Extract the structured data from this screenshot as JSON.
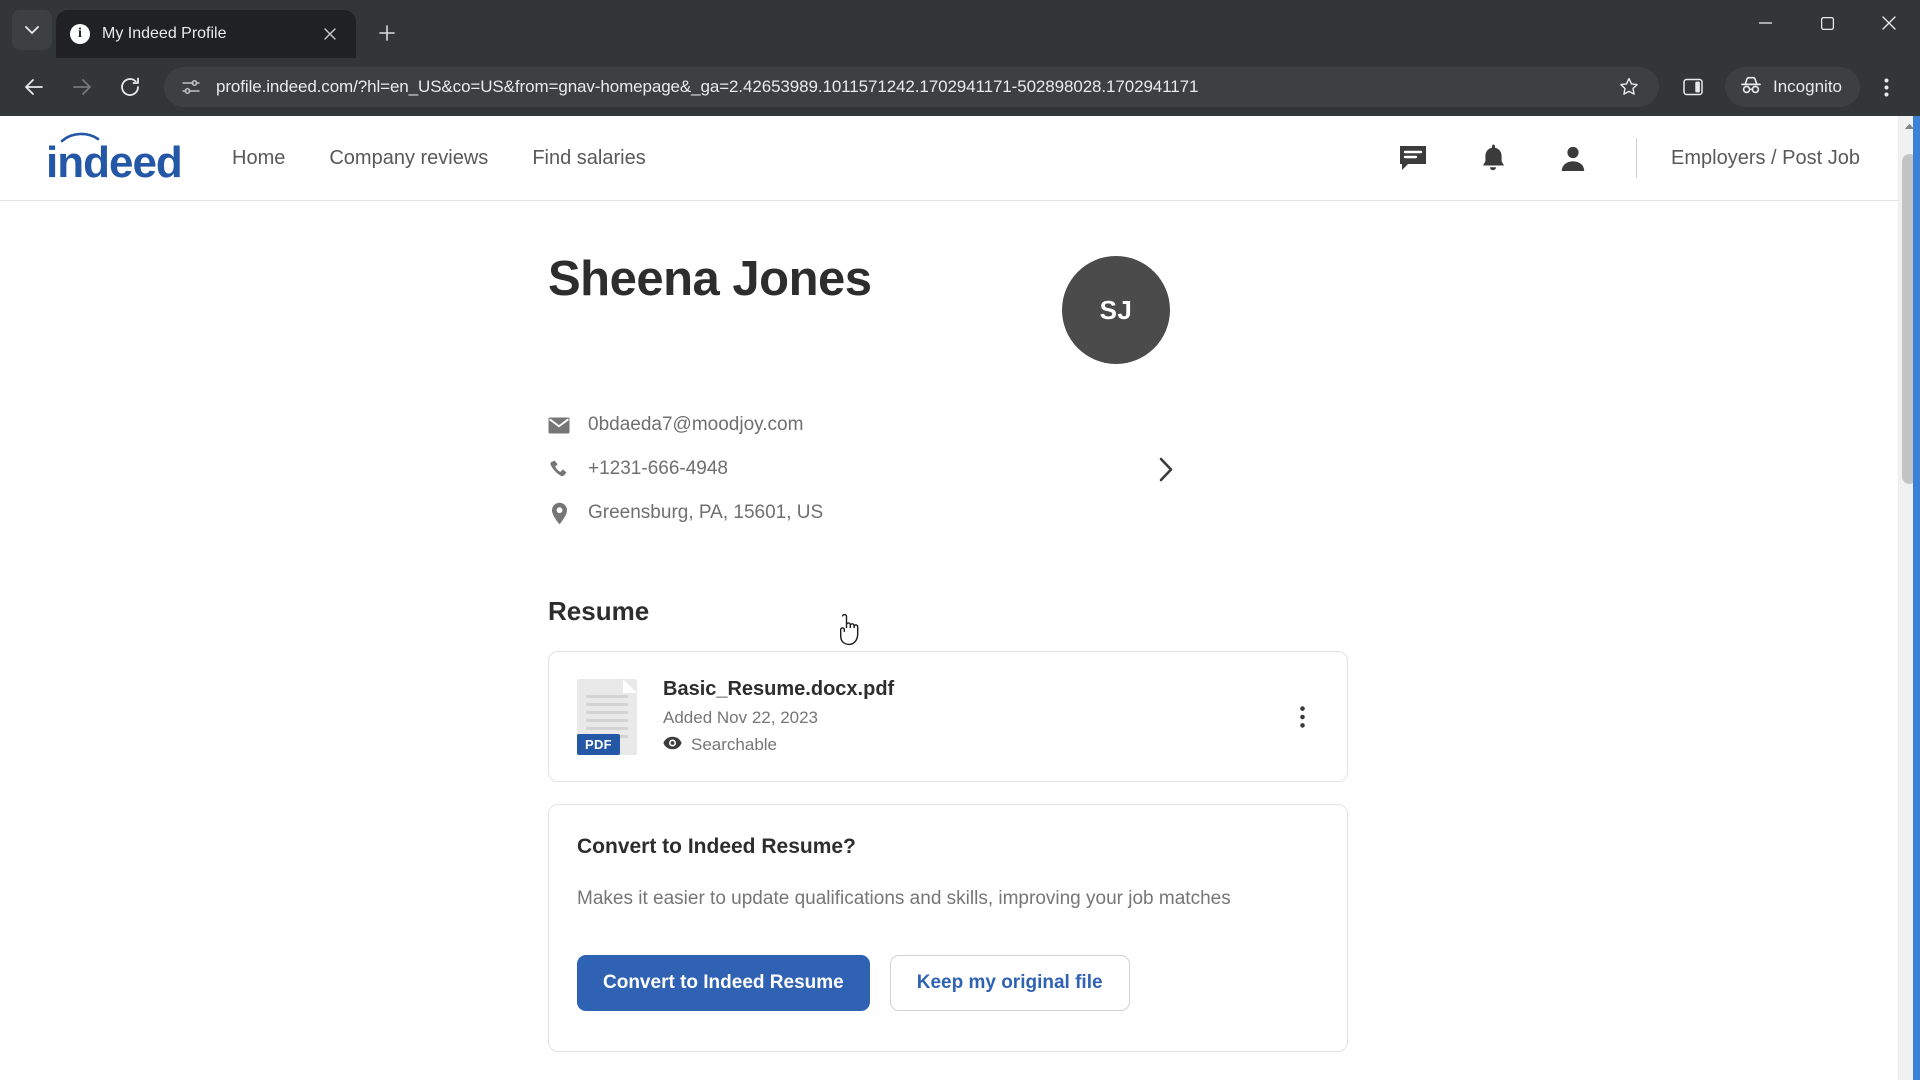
{
  "browser": {
    "tab": {
      "title": "My Indeed Profile",
      "favicon_icon": "info-circle-icon",
      "close_icon": "close-icon"
    },
    "new_tab_label": "+",
    "tab_list_icon": "chevron-down-icon",
    "window": {
      "minimize_icon": "minimize-icon",
      "maximize_icon": "maximize-icon",
      "close_icon": "window-close-icon"
    },
    "toolbar": {
      "back_icon": "back-arrow-icon",
      "forward_icon": "forward-arrow-icon",
      "reload_icon": "reload-icon",
      "site_info_icon": "site-settings-icon",
      "url": "profile.indeed.com/?hl=en_US&co=US&from=gnav-homepage&_ga=2.42653989.1011571242.1702941171-502898028.1702941171",
      "bookmark_icon": "star-icon",
      "side_panel_icon": "side-panel-icon",
      "incognito_label": "Incognito",
      "incognito_icon": "incognito-icon",
      "menu_icon": "three-dot-menu-icon"
    }
  },
  "site_header": {
    "logo_text": "indeed",
    "logo_color": "#2557a7",
    "nav": [
      {
        "label": "Home"
      },
      {
        "label": "Company reviews"
      },
      {
        "label": "Find salaries"
      }
    ],
    "icons": [
      {
        "name": "messages-icon"
      },
      {
        "name": "notifications-bell-icon"
      },
      {
        "name": "account-person-icon"
      }
    ],
    "employers_link": "Employers / Post Job"
  },
  "profile": {
    "name": "Sheena Jones",
    "avatar_initials": "SJ",
    "avatar_color": "#4b4b4b",
    "contact": [
      {
        "icon": "email-icon",
        "value": "0bdaeda7@moodjoy.com"
      },
      {
        "icon": "phone-icon",
        "value": "+1231-666-4948"
      },
      {
        "icon": "location-pin-icon",
        "value": "Greensburg, PA, 15601, US"
      }
    ],
    "expand_icon": "chevron-right-icon"
  },
  "resume_section": {
    "title": "Resume",
    "file": {
      "name": "Basic_Resume.docx.pdf",
      "added": "Added Nov 22, 2023",
      "searchable_label": "Searchable",
      "searchable_icon": "eye-icon",
      "format_badge": "PDF",
      "badge_color": "#2557a7",
      "menu_icon": "kebab-menu-icon"
    }
  },
  "convert_card": {
    "title": "Convert to Indeed Resume?",
    "description": "Makes it easier to update qualifications and skills, improving your job matches",
    "primary_button": "Convert to Indeed Resume",
    "secondary_button": "Keep my original file",
    "primary_color": "#2f62b3"
  },
  "scrollbar": {
    "up_arrow_icon": "scroll-up-arrow-icon",
    "thumb_name": "scrollbar-thumb"
  }
}
